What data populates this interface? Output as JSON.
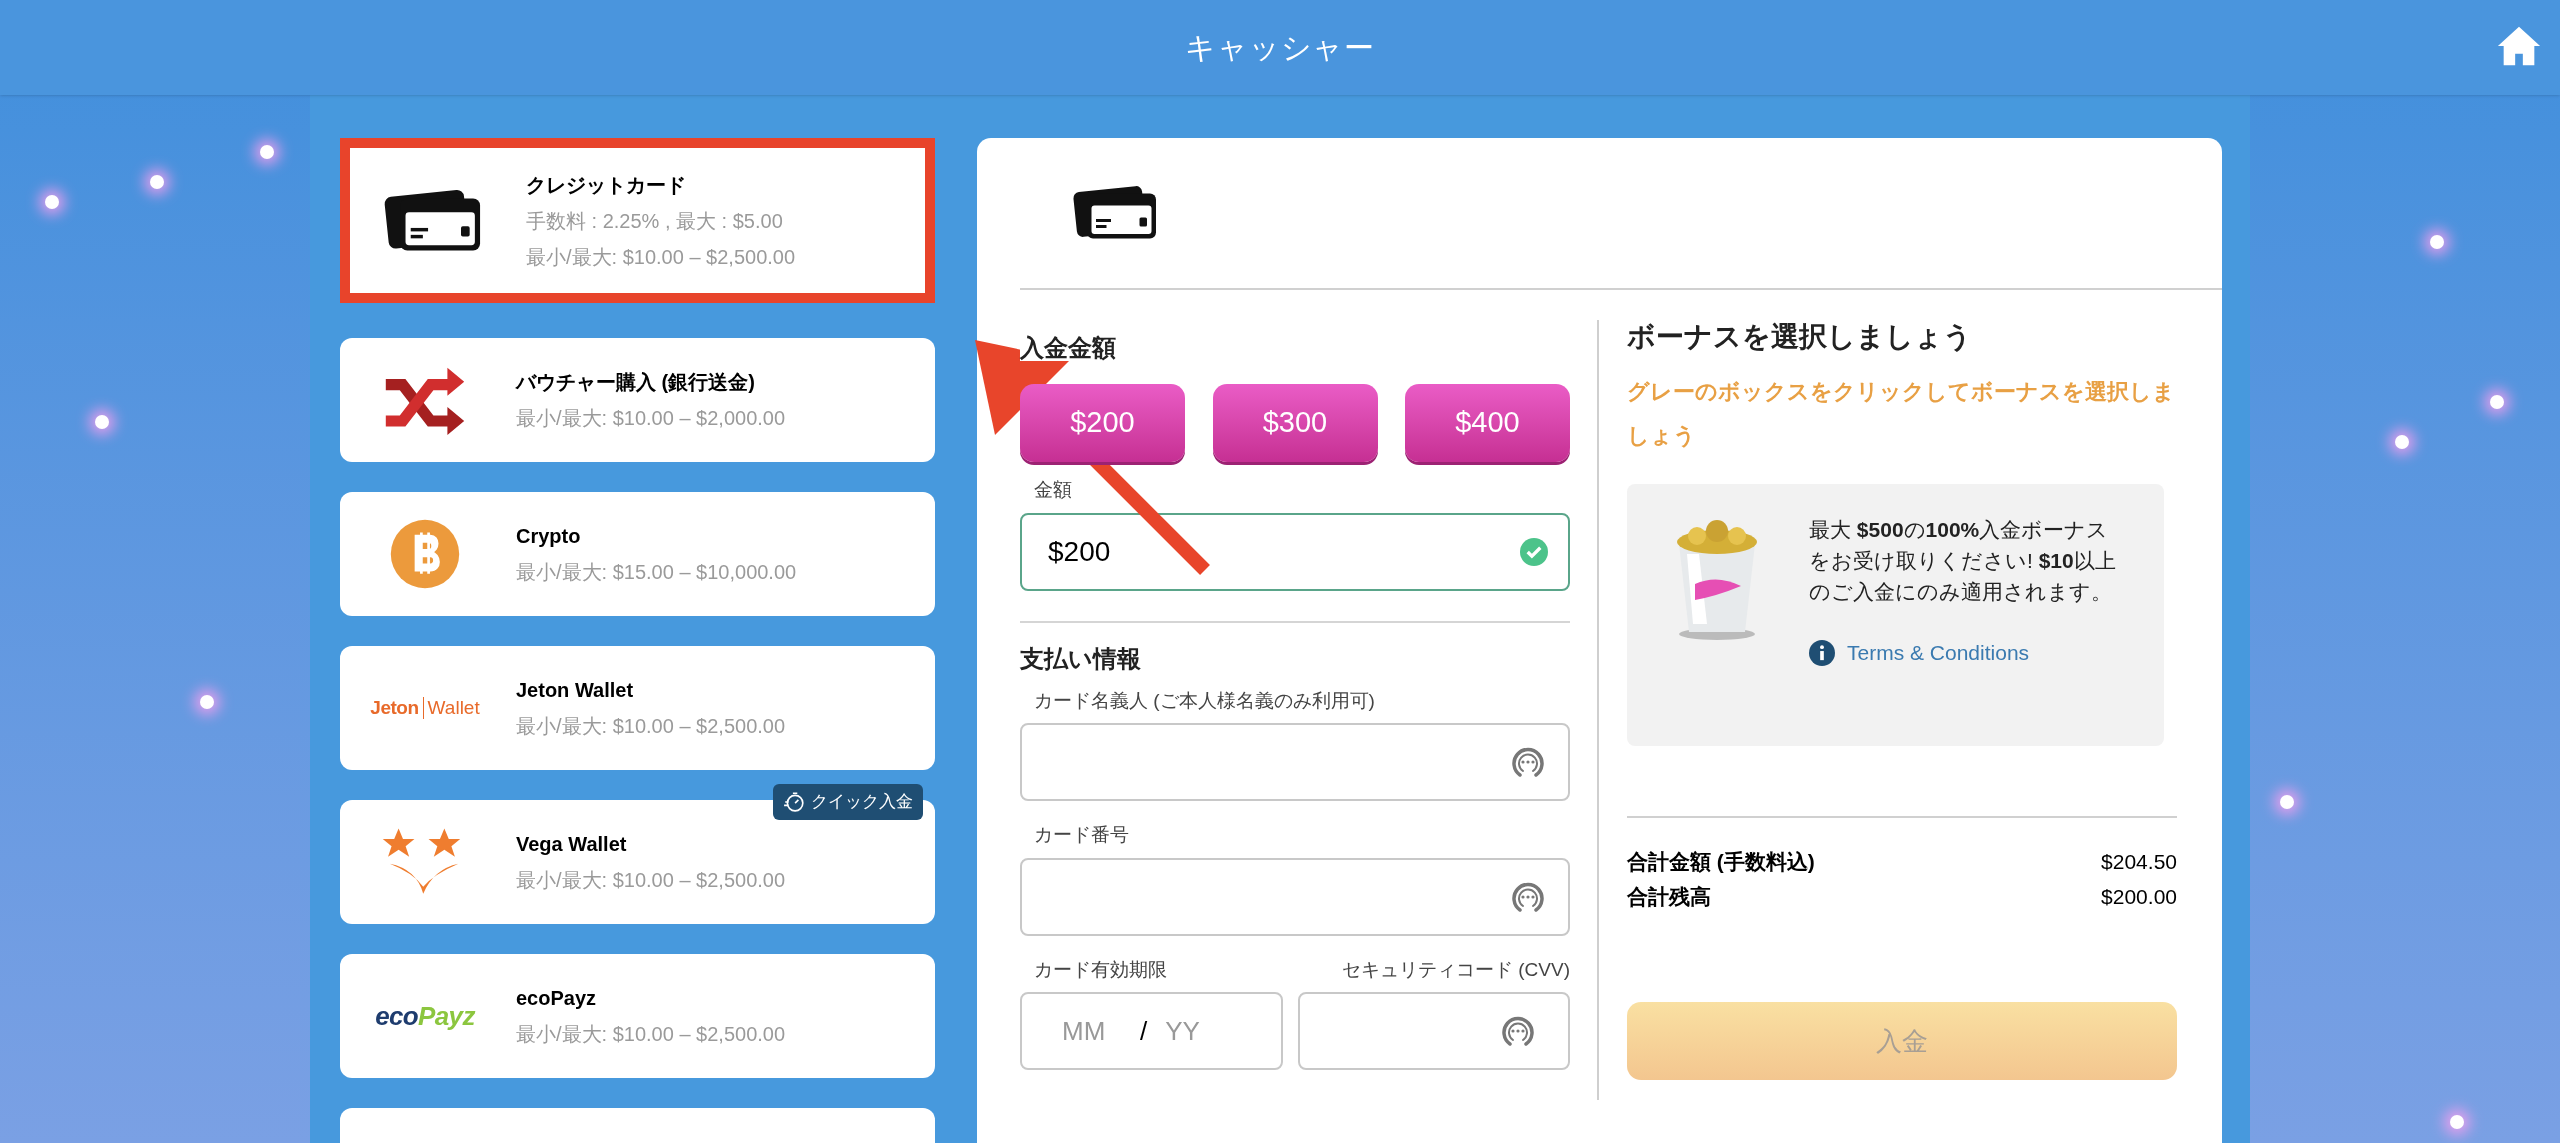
{
  "header": {
    "title": "キャッシャー"
  },
  "payment_methods": [
    {
      "kind": "card",
      "name": "クレジットカード",
      "details": [
        "手数料 : 2.25% , 最大 : $5.00",
        "最小/最大: $10.00 – $2,500.00"
      ],
      "highlighted": true
    },
    {
      "kind": "voucher",
      "name": "バウチャー購入 (銀行送金)",
      "details": [
        "最小/最大: $10.00 – $2,000.00"
      ],
      "highlighted": false
    },
    {
      "kind": "bitcoin",
      "name": "Crypto",
      "details": [
        "最小/最大: $15.00 – $10,000.00"
      ],
      "highlighted": false
    },
    {
      "kind": "jeton",
      "logo_text": [
        "Jeton",
        "Wallet"
      ],
      "name": "Jeton Wallet",
      "details": [
        "最小/最大: $10.00 – $2,500.00"
      ],
      "highlighted": false
    },
    {
      "kind": "vega",
      "name": "Vega Wallet",
      "details": [
        "最小/最大: $10.00 – $2,500.00"
      ],
      "badge": "クイック入金",
      "highlighted": false
    },
    {
      "kind": "ecopayz",
      "logo_text": [
        "eco",
        "Payz"
      ],
      "name": "ecoPayz",
      "details": [
        "最小/最大: $10.00 – $2,500.00"
      ],
      "highlighted": false
    }
  ],
  "deposit": {
    "heading": "入金金額",
    "presets": [
      {
        "label": "$200"
      },
      {
        "label": "$300"
      },
      {
        "label": "$400"
      }
    ],
    "amount": {
      "label": "金額",
      "value": "$200",
      "valid": true
    }
  },
  "payment_info": {
    "heading": "支払い情報",
    "fields": [
      {
        "label": "カード名義人 (ご本人様名義のみ利用可)"
      },
      {
        "label": "カード番号"
      }
    ],
    "expiry": {
      "label": "カード有効期限",
      "month_placeholder": "MM",
      "separator": "/",
      "year_placeholder": "YY"
    },
    "cvv": {
      "label": "セキュリティコード (CVV)"
    }
  },
  "bonus": {
    "heading": "ボーナスを選択しましょう",
    "hint": "グレーのボックスをクリックしてボーナスを選択しましょう",
    "offer": {
      "text": "最大 **$500**の**100%**入金ボーナスをお受け取りください! **$10**以上のご入金にのみ適用されます。",
      "terms_link": "Terms & Conditions"
    }
  },
  "totals": [
    {
      "label": "合計金額 (手数料込)",
      "value": "$204.50"
    },
    {
      "label": "合計残高",
      "value": "$200.00"
    }
  ],
  "submit": {
    "label": "入金",
    "disabled": true
  }
}
